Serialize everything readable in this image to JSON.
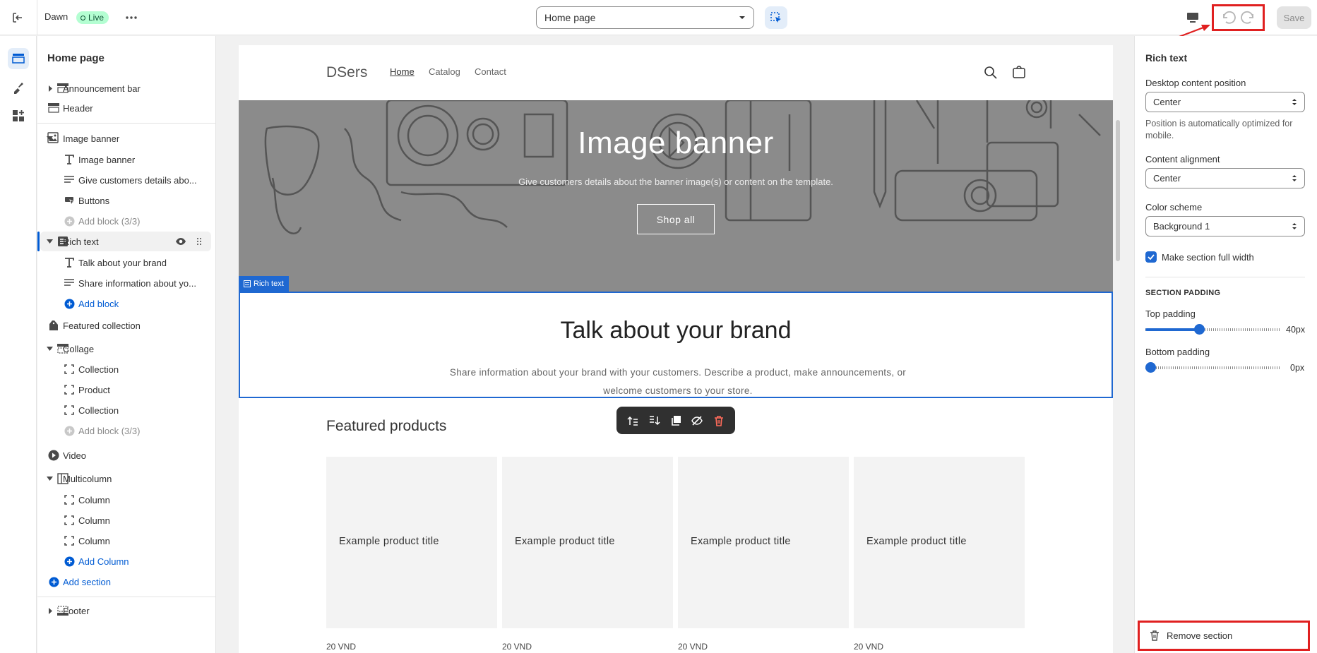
{
  "topbar": {
    "theme_name": "Dawn",
    "status_badge": "Live",
    "page_select": "Home page",
    "save_label": "Save"
  },
  "sidebar": {
    "title": "Home page",
    "items": [
      {
        "label": "Announcement bar"
      },
      {
        "label": "Header"
      },
      {
        "label": "Image banner"
      },
      {
        "label": "Image banner"
      },
      {
        "label": "Give customers details abo..."
      },
      {
        "label": "Buttons"
      },
      {
        "label": "Add block (3/3)"
      },
      {
        "label": "Rich text"
      },
      {
        "label": "Talk about your brand"
      },
      {
        "label": "Share information about yo..."
      },
      {
        "label": "Add block"
      },
      {
        "label": "Featured collection"
      },
      {
        "label": "Collage"
      },
      {
        "label": "Collection"
      },
      {
        "label": "Product"
      },
      {
        "label": "Collection"
      },
      {
        "label": "Add block (3/3)"
      },
      {
        "label": "Video"
      },
      {
        "label": "Multicolumn"
      },
      {
        "label": "Column"
      },
      {
        "label": "Column"
      },
      {
        "label": "Column"
      },
      {
        "label": "Add Column"
      },
      {
        "label": "Add section"
      },
      {
        "label": "Footer"
      }
    ]
  },
  "preview": {
    "store_logo": "DSers",
    "nav": [
      "Home",
      "Catalog",
      "Contact"
    ],
    "banner_title": "Image banner",
    "banner_subtitle": "Give customers details about the banner image(s) or content on the template.",
    "banner_button": "Shop all",
    "rich_text_tag": "Rich text",
    "rich_text_title": "Talk about your brand",
    "rich_text_body": "Share information about your brand with your customers. Describe a product, make announcements, or welcome customers to your store.",
    "featured_title": "Featured products",
    "products": [
      {
        "title": "Example product title",
        "price": "20 VND"
      },
      {
        "title": "Example product title",
        "price": "20 VND"
      },
      {
        "title": "Example product title",
        "price": "20 VND"
      },
      {
        "title": "Example product title",
        "price": "20 VND"
      }
    ]
  },
  "settings": {
    "title": "Rich text",
    "desktop_position_label": "Desktop content position",
    "desktop_position_value": "Center",
    "position_help": "Position is automatically optimized for mobile.",
    "alignment_label": "Content alignment",
    "alignment_value": "Center",
    "color_scheme_label": "Color scheme",
    "color_scheme_value": "Background 1",
    "full_width_label": "Make section full width",
    "full_width_checked": true,
    "padding_heading": "SECTION PADDING",
    "top_padding_label": "Top padding",
    "top_padding_value": "40px",
    "top_padding_fraction": 0.4,
    "bottom_padding_label": "Bottom padding",
    "bottom_padding_value": "0px",
    "bottom_padding_fraction": 0,
    "remove_label": "Remove section"
  },
  "colors": {
    "accent": "#005bd3",
    "annotation": "#e02020",
    "live_badge": "#b4fed2"
  }
}
